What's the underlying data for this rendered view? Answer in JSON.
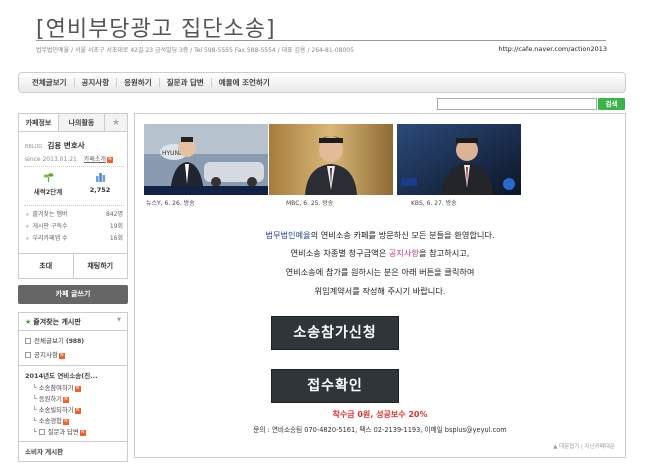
{
  "header": {
    "title": "[연비부당광고 집단소송]",
    "info": "법무법인예율 / 서울 서초구 서초대로 42길 23 금석빌딩 3층 / Tel 598-5555 Fax 588-5554 / 대표 김용 / 264-81-08005",
    "url": "http://cafe.naver.com/action2013"
  },
  "menu": [
    "전체글보기",
    "공지사항",
    "응원하기",
    "질문과 답변",
    "예율에 조언하기"
  ],
  "search": {
    "placeholder": "",
    "button": "검색"
  },
  "profile": {
    "tabs": [
      "카페정보",
      "나의활동",
      "★"
    ],
    "level": "BBLOG",
    "name": "김용 변호사",
    "since": "since 2013.01.21",
    "invite": "카페소개",
    "stats": [
      {
        "icon": "sprout-icon",
        "label": "새싹2단계"
      },
      {
        "icon": "people-icon",
        "value": "2,752"
      }
    ],
    "rows": [
      {
        "k": "즐겨찾는 멤버",
        "v": "842명"
      },
      {
        "k": "게시판 구독수",
        "v": "19회"
      },
      {
        "k": "우리카페앱 수",
        "v": "16회"
      }
    ],
    "buttons": [
      "초대",
      "채팅하기"
    ]
  },
  "write_button": "카페 글쓰기",
  "boards": {
    "header": "즐겨찾는 게시판",
    "items": [
      {
        "label": "전체글보기",
        "count": "(988)",
        "type": "top"
      },
      {
        "label": "공지사항",
        "new": true,
        "type": "top"
      },
      {
        "label": "2014년도 연비소송(진...",
        "type": "sec"
      },
      {
        "label": "소송참여하기",
        "new": true,
        "type": "sub"
      },
      {
        "label": "응원하기",
        "new": true,
        "type": "sub"
      },
      {
        "label": "소송빌되하기",
        "new": true,
        "type": "sub"
      },
      {
        "label": "소송경험",
        "new": true,
        "type": "sub"
      },
      {
        "label": "질문과 답변",
        "new": true,
        "type": "sub"
      },
      {
        "label": "소비자 게시판",
        "type": "sec2"
      }
    ]
  },
  "media": [
    {
      "caption": "뉴스Y, 6. 26. 방송",
      "logo": ""
    },
    {
      "caption": "MBC, 6. 25. 방송",
      "logo": ""
    },
    {
      "caption": "KBS, 6. 27. 방송",
      "logo": ""
    }
  ],
  "welcome": {
    "line1_firm": "법무법인예율",
    "line1_rest": "의 연비소송 카페를 방문하신 모든 분들을 환영합니다.",
    "line2_a": "연비소송 차종별 청구금액은 ",
    "line2_link": "공지사항",
    "line2_b": "을 참고하시고,",
    "line3": "연비소송에 참가를 원하시는 분은 아래 버튼을 클릭하여",
    "line4": "위임계약서를 작성해 주시기 바랍니다."
  },
  "buttons": {
    "apply": "소송참가신청",
    "check": "접수확인"
  },
  "promo": "착수금 0원, 성공보수 20%",
  "contact": "문의 : 연비소송팀 070-4820-5161, 팩스 02-2139-1193, 이메일 bsplus@yeyul.com",
  "footer_links": "▲ 대문접기 | 지난카페대문",
  "colors": {
    "accent": "#3cb44a",
    "button": "#2f3538",
    "promo": "#e03030",
    "link": "#2244aa"
  }
}
